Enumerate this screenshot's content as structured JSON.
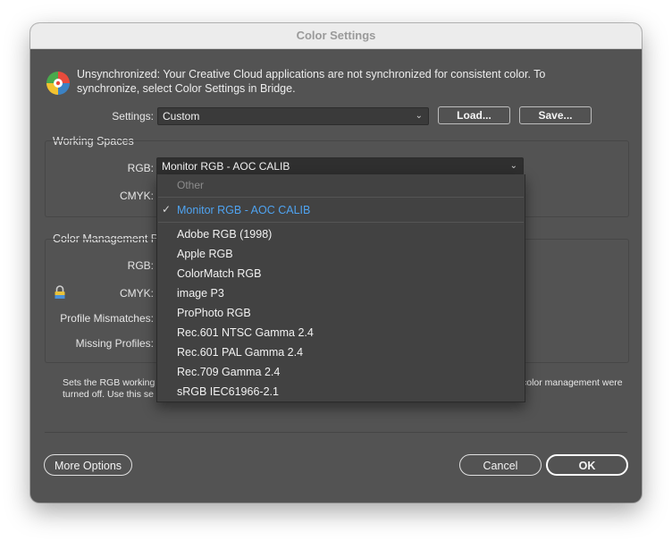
{
  "window": {
    "title": "Color Settings"
  },
  "info": {
    "icon": "color-wheel-icon",
    "text": "Unsynchronized: Your Creative Cloud applications are not synchronized for consistent color. To synchronize, select Color Settings in Bridge."
  },
  "settings": {
    "label": "Settings:",
    "value": "Custom",
    "load_label": "Load...",
    "save_label": "Save..."
  },
  "working_spaces": {
    "title": "Working Spaces",
    "rgb_label": "RGB:",
    "rgb_value": "Monitor RGB - AOC CALIB",
    "cmyk_label": "CMYK:"
  },
  "color_management": {
    "title": "Color Management P",
    "rgb_label": "RGB:",
    "cmyk_label": "CMYK:",
    "mismatch_label": "Profile Mismatches:",
    "missing_label": "Missing Profiles:",
    "lock_icon": "lock-icon"
  },
  "description": {
    "line1_left": "Sets the RGB working",
    "line1_right": "color management were",
    "line2_left": "turned off. Use this se"
  },
  "menu": {
    "header": "Other",
    "selected": "Monitor RGB - AOC CALIB",
    "items": [
      "Adobe RGB (1998)",
      "Apple RGB",
      "ColorMatch RGB",
      "image P3",
      "ProPhoto RGB",
      "Rec.601 NTSC Gamma 2.4",
      "Rec.601 PAL Gamma 2.4",
      "Rec.709 Gamma 2.4",
      "sRGB IEC61966-2.1"
    ]
  },
  "footer": {
    "more_options": "More Options",
    "cancel": "Cancel",
    "ok": "OK"
  },
  "colors": {
    "selected_item": "#4fa3f0",
    "dialog_bg": "#535353"
  }
}
